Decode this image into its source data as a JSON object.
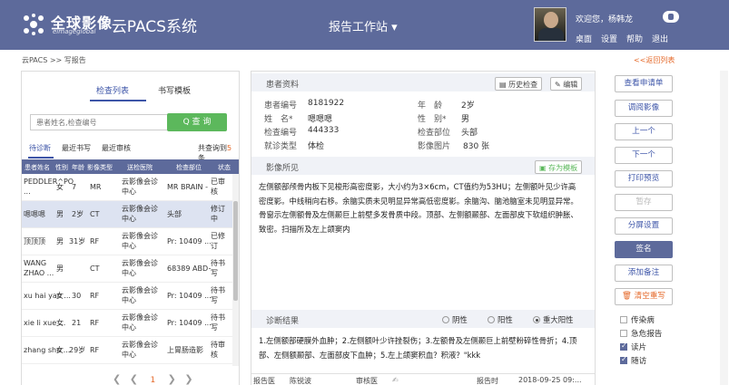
{
  "header": {
    "brand_cn": "全球影像",
    "brand_en": "eimageglobal",
    "app_title": "· 云PACS系统",
    "workstation": "报告工作站",
    "workstation_arrow": "▾",
    "welcome": "欢迎您，杨韩龙",
    "nav": [
      "桌面",
      "设置",
      "帮助",
      "退出"
    ]
  },
  "breadcrumb": "云PACS >> 写报告",
  "back_link": "<<返回列表",
  "left": {
    "tabs": [
      "检查列表",
      "书写模板"
    ],
    "search_placeholder": "患者姓名,检查编号",
    "search_button": "Q 查 询",
    "subtabs": [
      "待诊断",
      "最近书写",
      "最近审核"
    ],
    "total_prefix": "共查询到",
    "total_count": "5",
    "total_suffix": "条",
    "columns": [
      "患者姓名",
      "性别",
      "年龄",
      "影像类型",
      "送检医院",
      "检查部位",
      "状态"
    ],
    "rows": [
      {
        "name": "PEDDLER^PO ...",
        "sex": "女",
        "age": "7",
        "type": "MR",
        "hospital": "云影像会诊中心",
        "part": "MR BRAIN - ...",
        "status": "已审核"
      },
      {
        "name": "嗯嗯嗯",
        "sex": "男",
        "age": "2岁",
        "type": "CT",
        "hospital": "云影像会诊中心",
        "part": "头部",
        "status": "修订中"
      },
      {
        "name": "顶顶顶",
        "sex": "男",
        "age": "31岁",
        "type": "RF",
        "hospital": "云影像会诊中心",
        "part": "Pr: 10409 ...",
        "status": "已修订"
      },
      {
        "name": "WANG ZHAO ...",
        "sex": "男",
        "age": "",
        "type": "CT",
        "hospital": "云影像会诊中心",
        "part": "68389 ABD+...",
        "status": "待书写"
      },
      {
        "name": "xu hai yan ...",
        "sex": "女",
        "age": "30",
        "type": "RF",
        "hospital": "云影像会诊中心",
        "part": "Pr: 10409 ...",
        "status": "待书写"
      },
      {
        "name": "xie li xue ...",
        "sex": "女",
        "age": "21",
        "type": "RF",
        "hospital": "云影像会诊中心",
        "part": "Pr: 10409 ...",
        "status": "待书写"
      },
      {
        "name": "zhang shu ...",
        "sex": "女",
        "age": "29岁",
        "type": "RF",
        "hospital": "云影像会诊中心",
        "part": "上胃肠造影",
        "status": "待审核"
      }
    ],
    "pager": {
      "prev_first": "❮",
      "prev": "❮",
      "current": "1",
      "next": "❯",
      "last": "❯"
    }
  },
  "patient": {
    "section_title": "患者资料",
    "history_btn": "历史检查",
    "edit_btn": "编辑",
    "labels": {
      "id": "患者编号",
      "name": "姓　名*",
      "exam_no": "检查编号",
      "visit_type": "就诊类型",
      "age": "年　龄",
      "sex": "性　别*",
      "part": "检查部位",
      "images": "影像图片"
    },
    "values": {
      "id": "8181922",
      "name": "嗯嗯嗯",
      "exam_no": "444333",
      "visit_type": "体检",
      "age": "2岁",
      "sex": "男",
      "part": "头部",
      "images": "830 张"
    }
  },
  "findings": {
    "title": "影像所见",
    "save_template": "存为模板",
    "text": "左侧额部颅骨内板下见梭形高密度影，大小约为3×6cm，CT值约为53HU；左侧额叶见少许高密度影。中线稍向右移。余脑实质未见明显异常高低密度影。余脑沟、脑池脑室未见明显异常。骨窗示左侧额骨及左侧颞巨上前壁多发骨质中段。顶部、左侧额颞部、左面部皮下软组织肿胀、致密。扫描所及左上颌窦内"
  },
  "diagnosis": {
    "title": "诊断结果",
    "options": [
      "阴性",
      "阳性",
      "重大阳性"
    ],
    "selected": "重大阳性",
    "text": "1.左侧额部硬膜外血肿；2.左侧额叶少许挫裂伤；3.左额骨及左侧颞巨上前壁粉碎性骨折；4.顶部、左侧额颞部、左面部皮下血肿；5.左上颌窦积血？积液？\"kkk"
  },
  "footer": {
    "doctor_label": "报告医",
    "doctor": "陈锐波",
    "reviewer_label": "审核医",
    "report_time_label": "报告时",
    "report_time": "2018-09-25 09:..."
  },
  "actions": [
    "查看申请单",
    "调阅影像",
    "上一个",
    "下一个",
    "打印预览",
    "暂存",
    "分屏设置",
    "签名",
    "添加备注",
    "清空重写"
  ],
  "checks": [
    {
      "label": "传染病",
      "checked": false
    },
    {
      "label": "急危报告",
      "checked": false
    },
    {
      "label": "读片",
      "checked": true
    },
    {
      "label": "随访",
      "checked": true
    }
  ],
  "colors": {
    "header": "#5d6a9b",
    "accent": "#3d55a8",
    "search_btn": "#5cb85c",
    "orange": "#e56a2b"
  }
}
